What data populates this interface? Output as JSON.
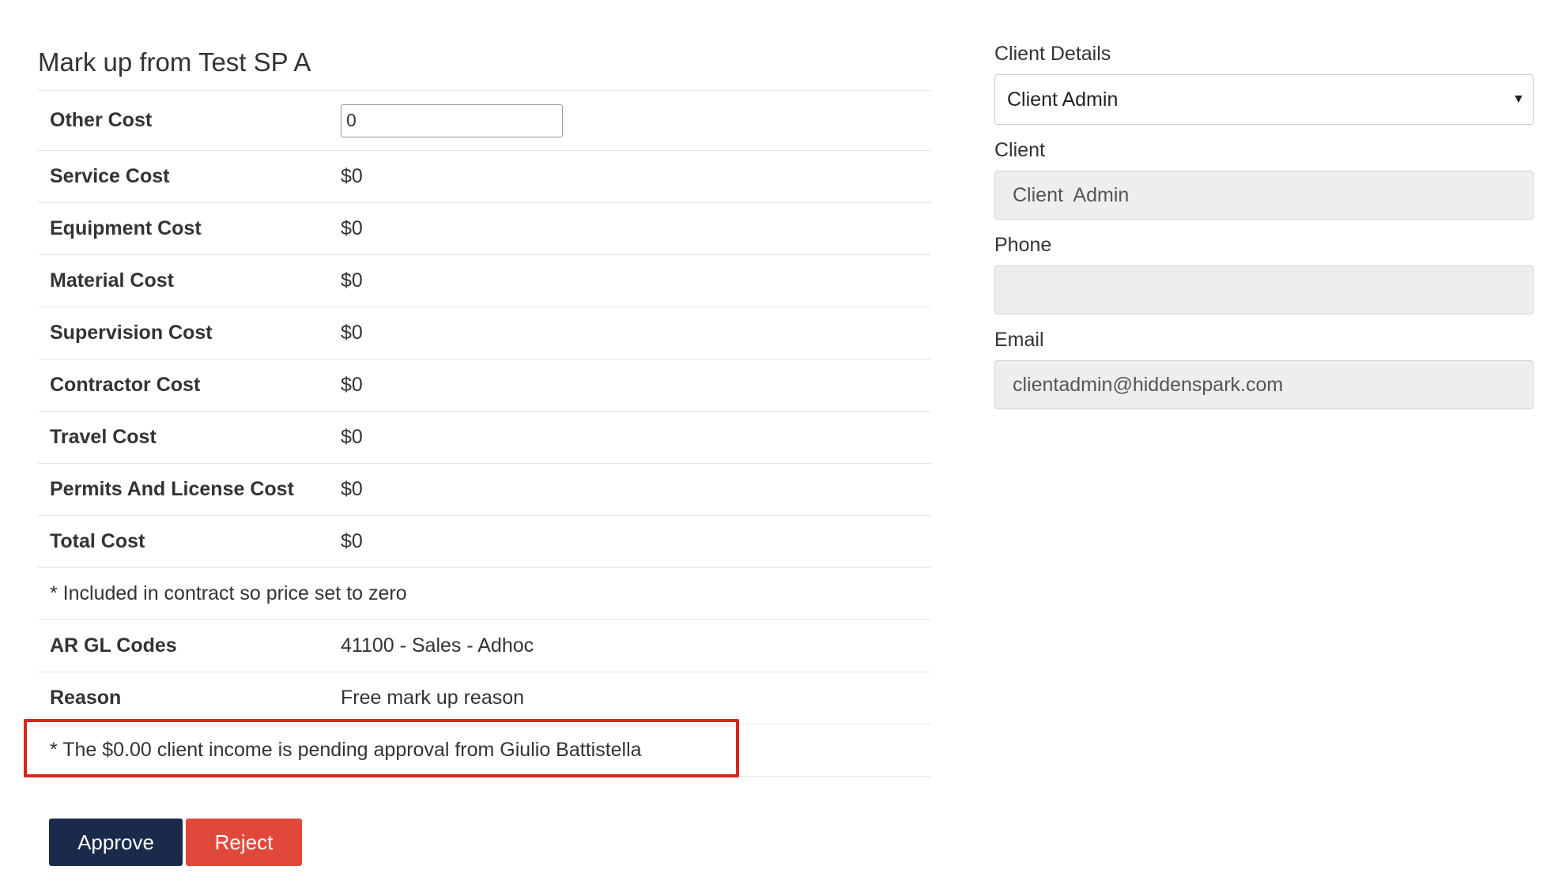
{
  "page": {
    "title": "Mark up from Test SP A"
  },
  "costs": {
    "other_cost_label": "Other Cost",
    "other_cost_value": "0",
    "rows": [
      {
        "label": "Service Cost",
        "value": "$0"
      },
      {
        "label": "Equipment Cost",
        "value": "$0"
      },
      {
        "label": "Material Cost",
        "value": "$0"
      },
      {
        "label": "Supervision Cost",
        "value": "$0"
      },
      {
        "label": "Contractor Cost",
        "value": "$0"
      },
      {
        "label": "Travel Cost",
        "value": "$0"
      },
      {
        "label": "Permits And License Cost",
        "value": "$0"
      },
      {
        "label": "Total Cost",
        "value": "$0"
      }
    ],
    "note": "* Included in contract so price set to zero",
    "gl_label": "AR GL Codes",
    "gl_value": "41100 - Sales - Adhoc",
    "reason_label": "Reason",
    "reason_value": "Free mark up reason",
    "pending_note": "* The $0.00 client income is pending approval from Giulio Battistella"
  },
  "actions": {
    "approve_label": "Approve",
    "reject_label": "Reject"
  },
  "client": {
    "details_label": "Client Details",
    "details_selected": "Client Admin",
    "client_label": "Client",
    "client_value": "Client  Admin",
    "phone_label": "Phone",
    "phone_value": "",
    "email_label": "Email",
    "email_value": "clientadmin@hiddenspark.com"
  },
  "colors": {
    "approve": "#1b2a4a",
    "reject": "#e0493a",
    "highlight": "#d9251d",
    "readonly_bg": "#eeeeee"
  },
  "icons": {
    "select_arrow": "caret-down-icon"
  }
}
